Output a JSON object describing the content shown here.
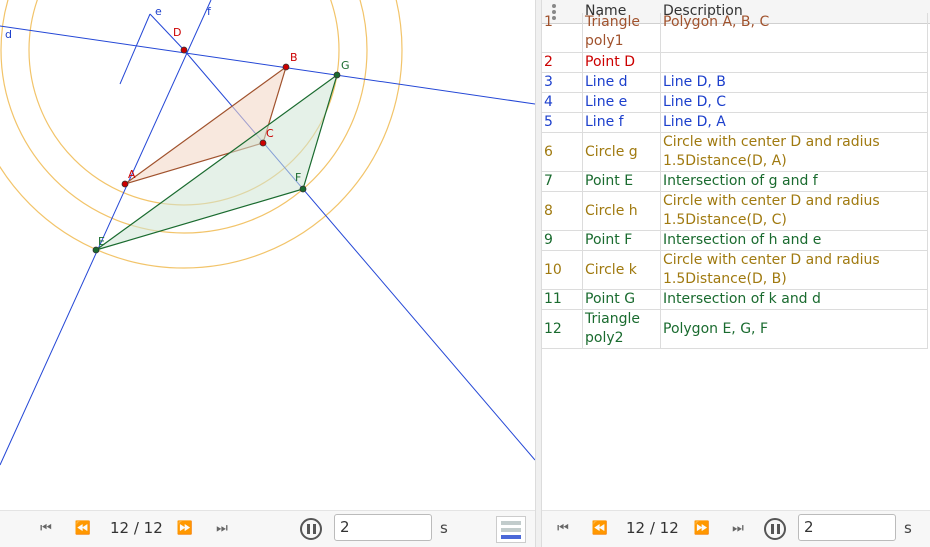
{
  "colors": {
    "polygon1": "#a0522d",
    "point_red": "#cc0000",
    "line_blue": "#1c3fcc",
    "circle_orange": "#a07a10",
    "green": "#1a6b2f"
  },
  "graphics": {
    "labels": {
      "d": "d",
      "e": "e",
      "f": "f",
      "D": "D",
      "B": "B",
      "G": "G",
      "A": "A",
      "C": "C",
      "F": "F",
      "E": "E"
    }
  },
  "navigation_left": {
    "step": "12 / 12",
    "speed": "2",
    "unit": "s",
    "icons": [
      "first-step-icon",
      "previous-step-icon",
      "next-step-icon",
      "last-step-icon",
      "pause-icon"
    ]
  },
  "navigation_right": {
    "step": "12 / 12",
    "speed": "2",
    "unit": "s"
  },
  "table": {
    "headers": {
      "name": "Name",
      "description": "Description"
    },
    "rows": [
      {
        "num": "1",
        "name": "Triangle poly1",
        "desc": "Polygon A, B, C",
        "color": "#a0522d"
      },
      {
        "num": "2",
        "name": "Point D",
        "desc": "",
        "color": "#cc0000"
      },
      {
        "num": "3",
        "name": "Line d",
        "desc": "Line D, B",
        "color": "#1c3fcc"
      },
      {
        "num": "4",
        "name": "Line e",
        "desc": "Line D, C",
        "color": "#1c3fcc"
      },
      {
        "num": "5",
        "name": "Line f",
        "desc": "Line D, A",
        "color": "#1c3fcc"
      },
      {
        "num": "6",
        "name": "Circle g",
        "desc": "Circle with center D and radius 1.5Distance(D, A)",
        "color": "#a07a10"
      },
      {
        "num": "7",
        "name": "Point E",
        "desc": "Intersection of g and f",
        "color": "#1a6b2f"
      },
      {
        "num": "8",
        "name": "Circle h",
        "desc": "Circle with center D and radius 1.5Distance(D, C)",
        "color": "#a07a10"
      },
      {
        "num": "9",
        "name": "Point F",
        "desc": "Intersection of h and e",
        "color": "#1a6b2f"
      },
      {
        "num": "10",
        "name": "Circle k",
        "desc": "Circle with center D and radius 1.5Distance(D, B)",
        "color": "#a07a10"
      },
      {
        "num": "11",
        "name": "Point G",
        "desc": "Intersection of k and d",
        "color": "#1a6b2f"
      },
      {
        "num": "12",
        "name": "Triangle poly2",
        "desc": "Polygon E, G, F",
        "color": "#1a6b2f"
      }
    ]
  }
}
